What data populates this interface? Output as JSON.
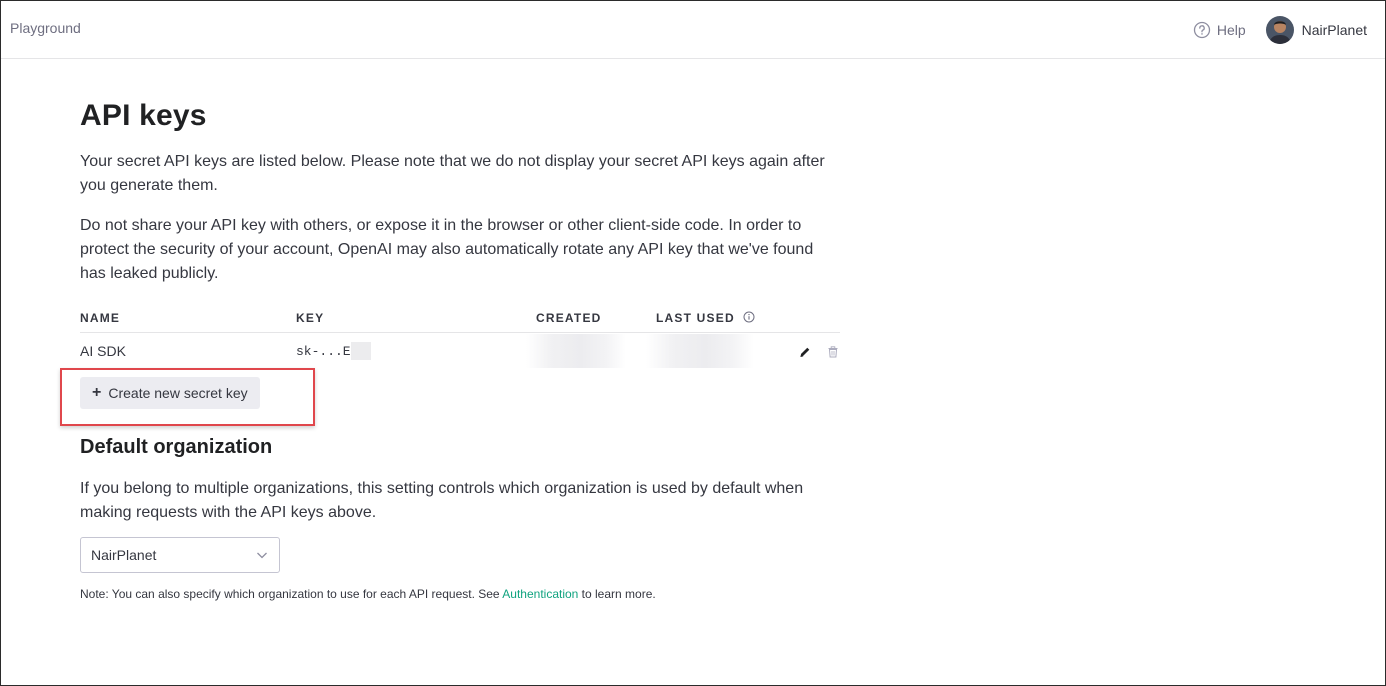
{
  "topbar": {
    "brand": "Playground",
    "help_label": "Help",
    "user_name": "NairPlanet"
  },
  "page": {
    "title": "API keys",
    "desc1": "Your secret API keys are listed below. Please note that we do not display your secret API keys again after you generate them.",
    "desc2": "Do not share your API key with others, or expose it in the browser or other client-side code. In order to protect the security of your account, OpenAI may also automatically rotate any API key that we've found has leaked publicly."
  },
  "table": {
    "headers": [
      "NAME",
      "KEY",
      "CREATED",
      "LAST USED"
    ],
    "rows": [
      {
        "name": "AI SDK",
        "key": "sk-...E"
      }
    ]
  },
  "create_button_label": "Create new secret key",
  "org": {
    "title": "Default organization",
    "desc": "If you belong to multiple organizations, this setting controls which organization is used by default when making requests with the API keys above.",
    "selected": "NairPlanet",
    "note_prefix": "Note: You can also specify which organization to use for each API request. See ",
    "note_link": "Authentication",
    "note_suffix": " to learn more."
  },
  "colors": {
    "accent_link": "#10a37f",
    "highlight_border": "#e0474c"
  }
}
